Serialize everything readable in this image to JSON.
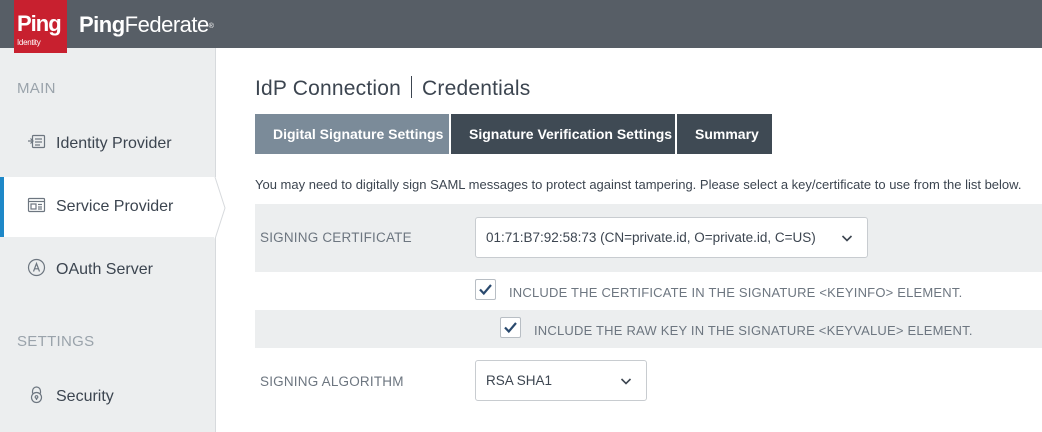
{
  "brand": {
    "logo_word": "Ping",
    "logo_sub": "Identity",
    "title_part1": "Ping",
    "title_part2": "Federate",
    "trademark": "®"
  },
  "sidebar": {
    "sections": [
      {
        "label": "MAIN"
      },
      {
        "label": "SETTINGS"
      }
    ],
    "items": [
      {
        "label": "Identity Provider",
        "icon": "identity-provider-icon"
      },
      {
        "label": "Service Provider",
        "icon": "service-provider-icon",
        "active": true
      },
      {
        "label": "OAuth Server",
        "icon": "oauth-server-icon"
      },
      {
        "label": "Security",
        "icon": "lock-icon"
      }
    ]
  },
  "page": {
    "title_primary": "IdP Connection",
    "title_secondary": "Credentials"
  },
  "tabs": [
    {
      "label": "Digital Signature Settings",
      "active": true
    },
    {
      "label": "Signature Verification Settings"
    },
    {
      "label": "Summary"
    }
  ],
  "intro_text": "You may need to digitally sign SAML messages to protect against tampering. Please select a key/certificate to use from the list below.",
  "form": {
    "signing_certificate": {
      "label": "SIGNING CERTIFICATE",
      "value": "01:71:B7:92:58:73 (CN=private.id, O=private.id, C=US)"
    },
    "include_cert": {
      "label": "INCLUDE THE CERTIFICATE IN THE SIGNATURE <KEYINFO> ELEMENT.",
      "checked": true
    },
    "include_raw_key": {
      "label": "INCLUDE THE RAW KEY IN THE SIGNATURE <KEYVALUE> ELEMENT.",
      "checked": true
    },
    "signing_algorithm": {
      "label": "SIGNING ALGORITHM",
      "value": "RSA SHA1"
    }
  },
  "colors": {
    "header": "#575e66",
    "logo": "#c8202f",
    "sidebar": "#eceeef",
    "active_accent": "#1e88c8",
    "tab_dark": "#3f4a54",
    "tab_active": "#7b8b99",
    "check": "#2a4a6e"
  }
}
